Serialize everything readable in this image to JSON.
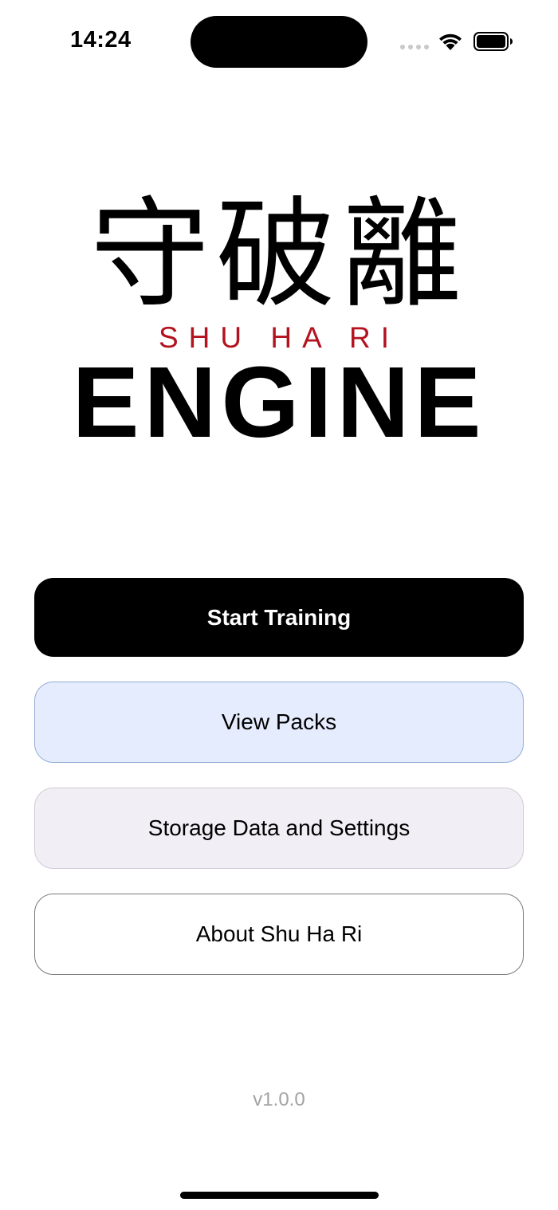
{
  "status_bar": {
    "time": "14:24",
    "icons": [
      "cellular-signal-icon",
      "wifi-icon",
      "battery-icon"
    ]
  },
  "logo": {
    "kanji": "守破離",
    "subtitle": "SHU HA RI",
    "wordmark": "ENGINE",
    "accent_color": "#b3121f"
  },
  "menu": {
    "start_training": "Start Training",
    "view_packs": "View Packs",
    "storage_settings": "Storage Data and Settings",
    "about": "About Shu Ha Ri"
  },
  "footer": {
    "version": "v1.0.0"
  }
}
